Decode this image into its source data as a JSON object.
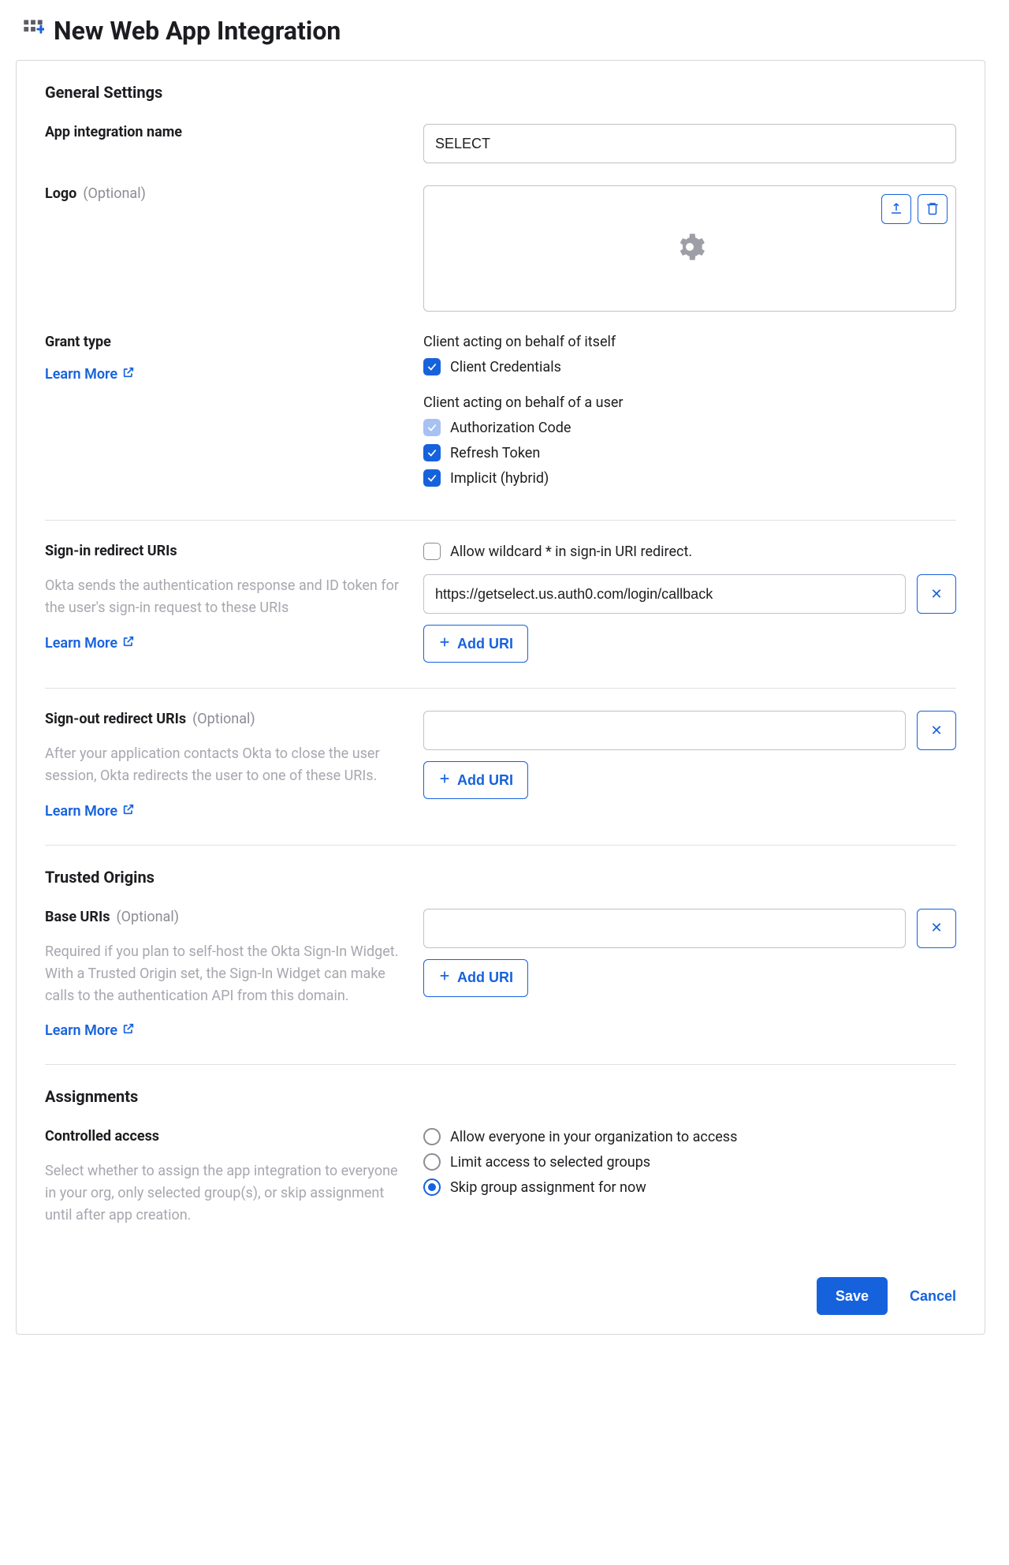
{
  "page_title": "New Web App Integration",
  "sections": {
    "general": {
      "heading": "General Settings",
      "app_name_label": "App integration name",
      "app_name_value": "SELECT",
      "logo_label": "Logo",
      "logo_optional": "(Optional)",
      "grant_type_label": "Grant type",
      "grant_self_heading": "Client acting on behalf of itself",
      "grant_client_credentials": "Client Credentials",
      "grant_user_heading": "Client acting on behalf of a user",
      "grant_auth_code": "Authorization Code",
      "grant_refresh": "Refresh Token",
      "grant_implicit": "Implicit (hybrid)"
    },
    "signin": {
      "label": "Sign-in redirect URIs",
      "help": "Okta sends the authentication response and ID token for the user's sign-in request to these URIs",
      "wildcard_label": "Allow wildcard * in sign-in URI redirect.",
      "uri_value": "https://getselect.us.auth0.com/login/callback",
      "add_label": "Add URI"
    },
    "signout": {
      "label": "Sign-out redirect URIs",
      "optional": "(Optional)",
      "help": "After your application contacts Okta to close the user session, Okta redirects the user to one of these URIs.",
      "add_label": "Add URI"
    },
    "trusted": {
      "heading": "Trusted Origins",
      "base_label": "Base URIs",
      "optional": "(Optional)",
      "help": "Required if you plan to self-host the Okta Sign-In Widget. With a Trusted Origin set, the Sign-In Widget can make calls to the authentication API from this domain.",
      "add_label": "Add URI"
    },
    "assignments": {
      "heading": "Assignments",
      "controlled_label": "Controlled access",
      "help": "Select whether to assign the app integration to everyone in your org, only selected group(s), or skip assignment until after app creation.",
      "options": {
        "everyone": "Allow everyone in your organization to access",
        "groups": "Limit access to selected groups",
        "skip": "Skip group assignment for now"
      }
    }
  },
  "common": {
    "learn_more": "Learn More",
    "save": "Save",
    "cancel": "Cancel"
  }
}
